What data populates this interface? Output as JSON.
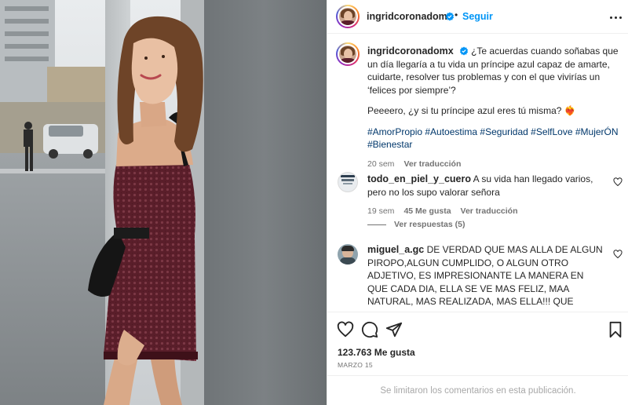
{
  "post": {
    "author": "ingridcoronadomx",
    "follow_label": "Seguir",
    "separator": "•",
    "caption": {
      "line1": "¿Te acuerdas cuando soñabas que un día llegaría a tu vida un príncipe azul capaz de amarte, cuidarte, resolver tus problemas y con el que vivirías un ‘felices por siempre’?",
      "line2": "Peeeero, ¿y si tu príncipe azul eres tú misma? ❤️‍🔥",
      "hashtags": [
        "#AmorPropio",
        "#Autoestima",
        "#Seguridad",
        "#SelfLove",
        "#MujerÓN",
        "#Bienestar"
      ],
      "age": "20 sem",
      "translate": "Ver traducción"
    }
  },
  "comments": [
    {
      "user": "todo_en_piel_y_cuero",
      "text": "A su vida han llegado varios, pero no los supo valorar señora",
      "age": "19 sem",
      "likes": "45 Me gusta",
      "translate": "Ver traducción",
      "replies_label": "Ver respuestas (5)"
    },
    {
      "user": "miguel_a.gc",
      "text": "DE VERDAD QUE MAS ALLA DE ALGUN PIROPO,ALGUN CUMPLIDO, O ALGUN OTRO ADJETIVO, ES IMPRESIONANTE LA MANERA EN QUE CADA DIA, ELLA SE VE MAS FELIZ, MAA NATURAL, MAS REALIZADA, MAS ELLA!!! QUE BONITA,GUAPA, INTELIGENTE,SEXY Y BELLA ES!!! DE VERDAD...."
    }
  ],
  "footer": {
    "likes": "123.763 Me gusta",
    "date": "MARZO 15",
    "comments_closed": "Se limitaron los comentarios en esta publicación."
  },
  "icons": {
    "verified": "verified-badge-icon",
    "more": "more-options-icon",
    "like": "heart-icon",
    "comment": "comment-icon",
    "share": "paper-plane-icon",
    "save": "bookmark-icon"
  },
  "colors": {
    "accent": "#0095f6",
    "hashtag": "#00376b",
    "muted": "#737373",
    "dress": "#5a1e2a"
  }
}
